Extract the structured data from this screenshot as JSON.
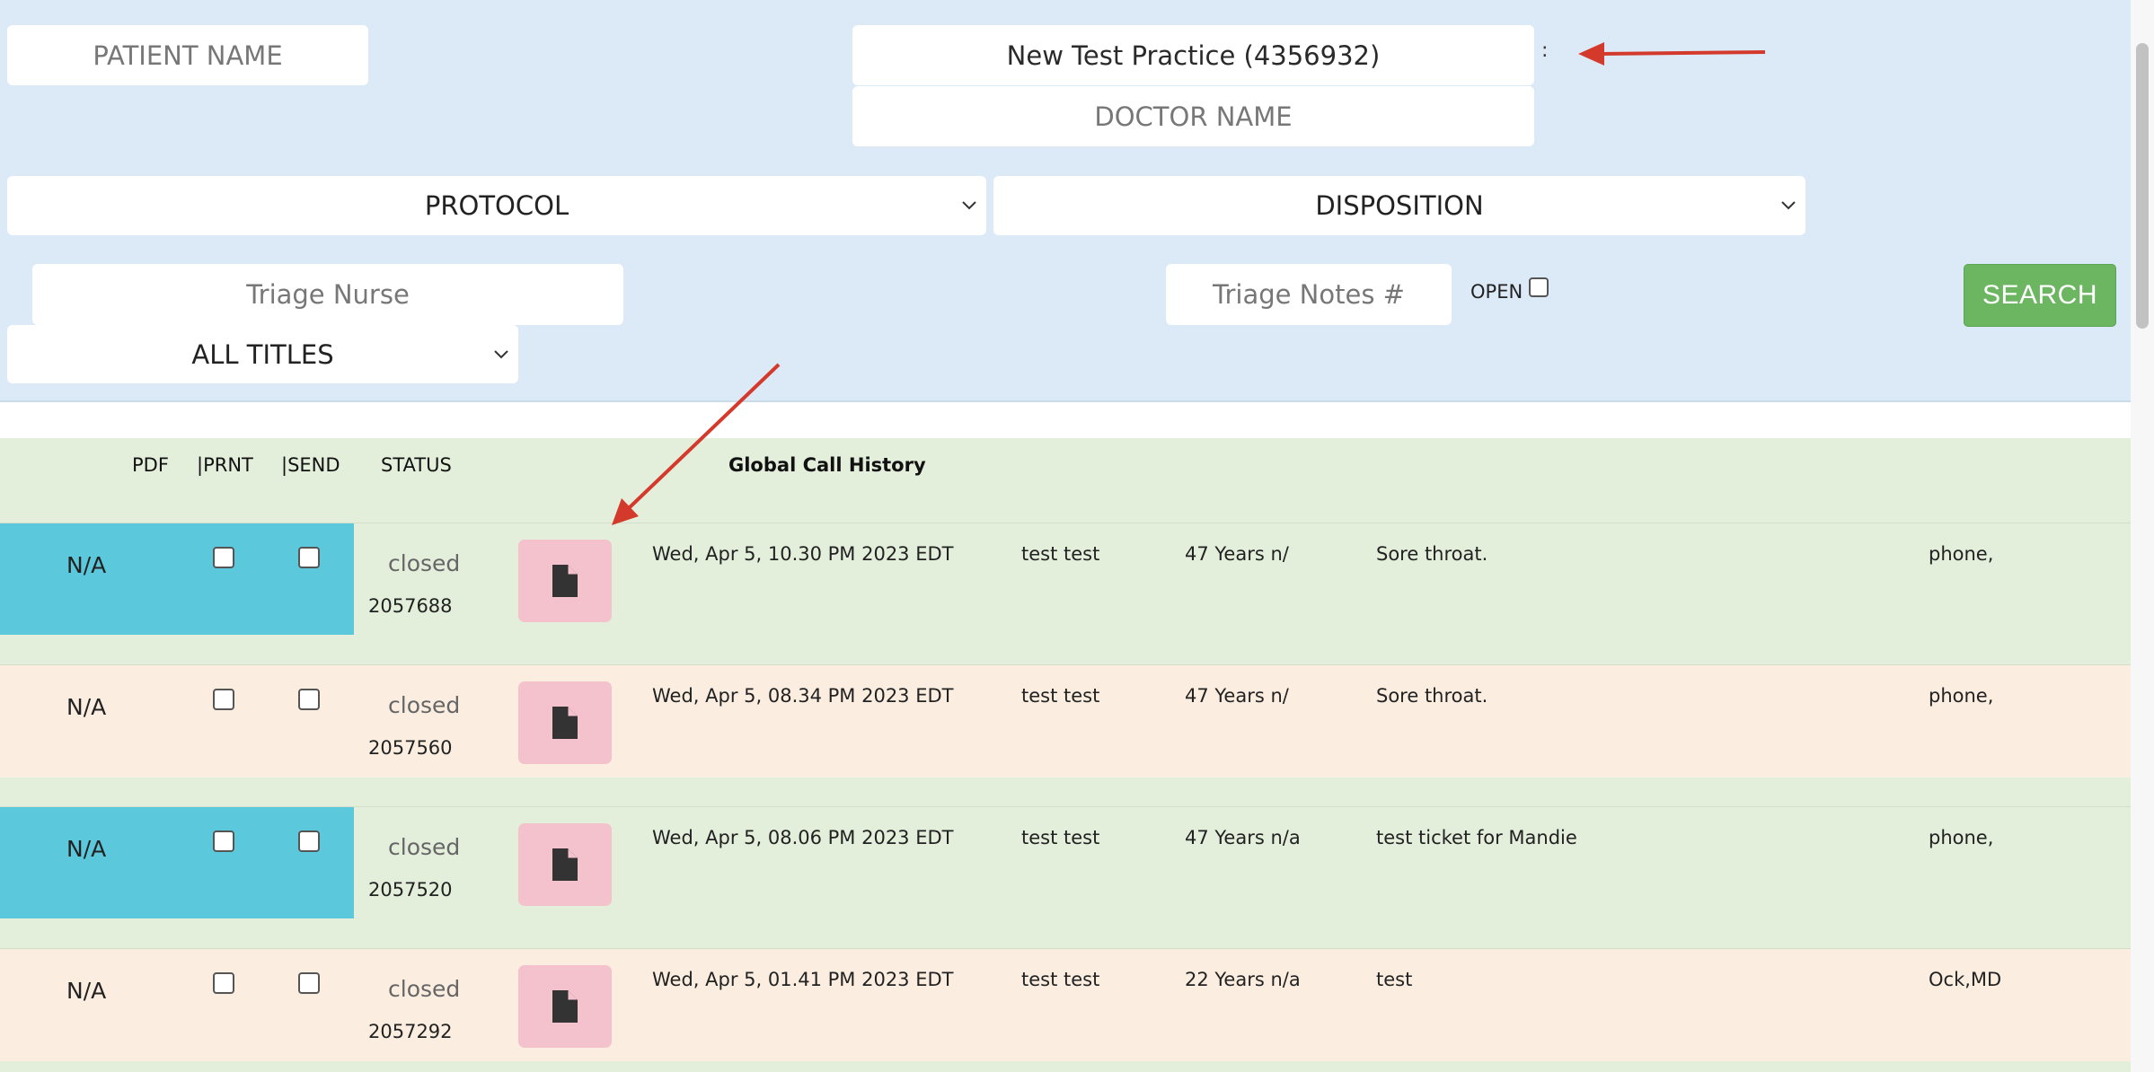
{
  "filters": {
    "patient_name_placeholder": "PATIENT NAME",
    "practice_value": "New Test Practice (4356932)",
    "practice_suffix": ":",
    "doctor_name_placeholder": "DOCTOR NAME",
    "protocol_select": "PROTOCOL",
    "disposition_select": "DISPOSITION",
    "triage_nurse_placeholder": "Triage Nurse",
    "triage_notes_placeholder": "Triage Notes #",
    "open_label": "OPEN",
    "titles_select": "ALL TITLES",
    "search_button": "SEARCH"
  },
  "table": {
    "headers": {
      "pdf": "PDF",
      "prnt": "|PRNT",
      "send": "|SEND",
      "status": "STATUS",
      "title": "Global Call History"
    },
    "rows": [
      {
        "na": "N/A",
        "status": "closed",
        "id": "2057688",
        "datetime": "Wed, Apr 5, 10.30 PM 2023 EDT",
        "patient": "test test",
        "age": "47 Years n/",
        "reason": "Sore throat.",
        "contact": "phone,"
      },
      {
        "na": "N/A",
        "status": "closed",
        "id": "2057560",
        "datetime": "Wed, Apr 5, 08.34 PM 2023 EDT",
        "patient": "test test",
        "age": "47 Years n/",
        "reason": "Sore throat.",
        "contact": "phone,"
      },
      {
        "na": "N/A",
        "status": "closed",
        "id": "2057520",
        "datetime": "Wed, Apr 5, 08.06 PM 2023 EDT",
        "patient": "test test",
        "age": "47 Years n/a",
        "reason": "test ticket for Mandie",
        "contact": "phone,"
      },
      {
        "na": "N/A",
        "status": "closed",
        "id": "2057292",
        "datetime": "Wed, Apr 5, 01.41 PM 2023 EDT",
        "patient": "test test",
        "age": "22 Years n/a",
        "reason": "test",
        "contact": "Ock,MD"
      }
    ]
  },
  "colors": {
    "filter_bg": "#dce9f6",
    "row_green": "#e3eedb",
    "row_peach": "#fbeee0",
    "status_blue": "#5bc8dc",
    "pdf_button": "#f4c2cd",
    "search_green": "#6cb662",
    "annotation_arrow": "#d33a2c"
  },
  "icons": {
    "pdf_row_icon": "document-icon",
    "select_chevron": "chevron-down-icon"
  }
}
